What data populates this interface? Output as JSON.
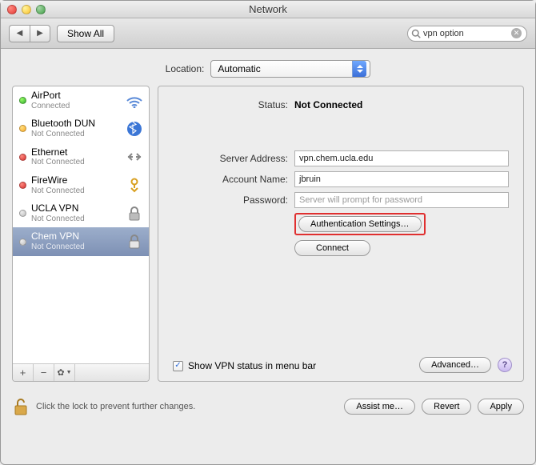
{
  "window": {
    "title": "Network"
  },
  "toolbar": {
    "show_all": "Show All",
    "search": {
      "value": "vpn option"
    }
  },
  "location": {
    "label": "Location:",
    "value": "Automatic"
  },
  "sidebar": {
    "items": [
      {
        "name": "AirPort",
        "sub": "Connected",
        "dot": "green",
        "icon": "airport"
      },
      {
        "name": "Bluetooth DUN",
        "sub": "Not Connected",
        "dot": "yellow",
        "icon": "bluetooth"
      },
      {
        "name": "Ethernet",
        "sub": "Not Connected",
        "dot": "red",
        "icon": "ethernet"
      },
      {
        "name": "FireWire",
        "sub": "Not Connected",
        "dot": "red",
        "icon": "firewire"
      },
      {
        "name": "UCLA VPN",
        "sub": "Not Connected",
        "dot": "grey",
        "icon": "vpn"
      },
      {
        "name": "Chem VPN",
        "sub": "Not Connected",
        "dot": "grey",
        "icon": "vpn",
        "selected": true
      }
    ]
  },
  "detail": {
    "status_label": "Status:",
    "status_value": "Not Connected",
    "server_label": "Server Address:",
    "server_value": "vpn.chem.ucla.edu",
    "account_label": "Account Name:",
    "account_value": "jbruin",
    "password_label": "Password:",
    "password_placeholder": "Server will prompt for password",
    "auth_btn": "Authentication Settings…",
    "connect_btn": "Connect",
    "show_status_label": "Show VPN status in menu bar",
    "show_status_checked": true,
    "advanced_btn": "Advanced…"
  },
  "bottom": {
    "lock_text": "Click the lock to prevent further changes.",
    "assist": "Assist me…",
    "revert": "Revert",
    "apply": "Apply"
  }
}
